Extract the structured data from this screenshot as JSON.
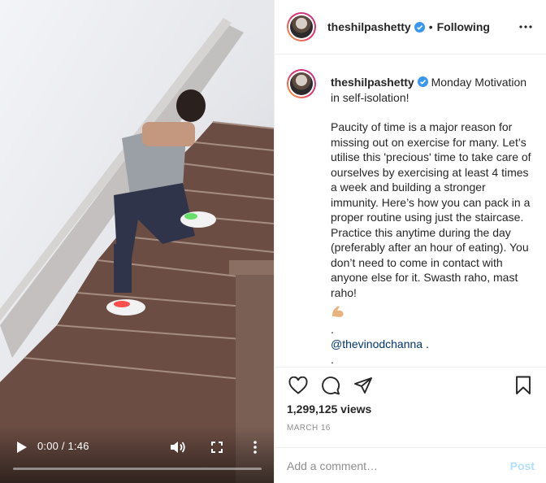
{
  "video": {
    "time_label": "0:00 / 1:46",
    "progress": 0.0,
    "icons": {
      "play": "play-icon",
      "volume": "volume-icon",
      "fullscreen": "fullscreen-icon",
      "more": "more-vertical-icon"
    }
  },
  "header": {
    "username": "theshilpashetty",
    "separator": "•",
    "following_label": "Following",
    "icons": {
      "verified": "verified-badge-icon",
      "more": "more-horizontal-icon"
    }
  },
  "caption": {
    "username": "theshilpashetty",
    "first_line": " Monday Motivation in self-isolation!",
    "body": "Paucity of time is a major reason for missing out on exercise for many. Let’s utilise this 'precious' time to take care of ourselves by exercising at least 4 times a week and building a stronger immunity. Here’s how you can pack in a proper routine using just the staircase. Practice this anytime during the day (preferably after an hour of eating). You don’t need to come in contact with anyone else for it. Swasth raho, mast raho!",
    "emoji": "flexed-biceps-emoji",
    "dot1": ".",
    "mention": "@thevinodchanna",
    "mention_suffix": " .",
    "dot2": "."
  },
  "actions": {
    "icons": {
      "like": "heart-icon",
      "comment": "comment-icon",
      "share": "share-icon",
      "save": "bookmark-icon"
    },
    "views": "1,299,125 views",
    "date": "MARCH 16"
  },
  "comment_box": {
    "placeholder": "Add a comment…",
    "post_label": "Post"
  },
  "colors": {
    "verified": "#3897f0",
    "mention": "#00376b",
    "post_disabled": "#b2dffc",
    "muted": "#8e8e8e"
  }
}
